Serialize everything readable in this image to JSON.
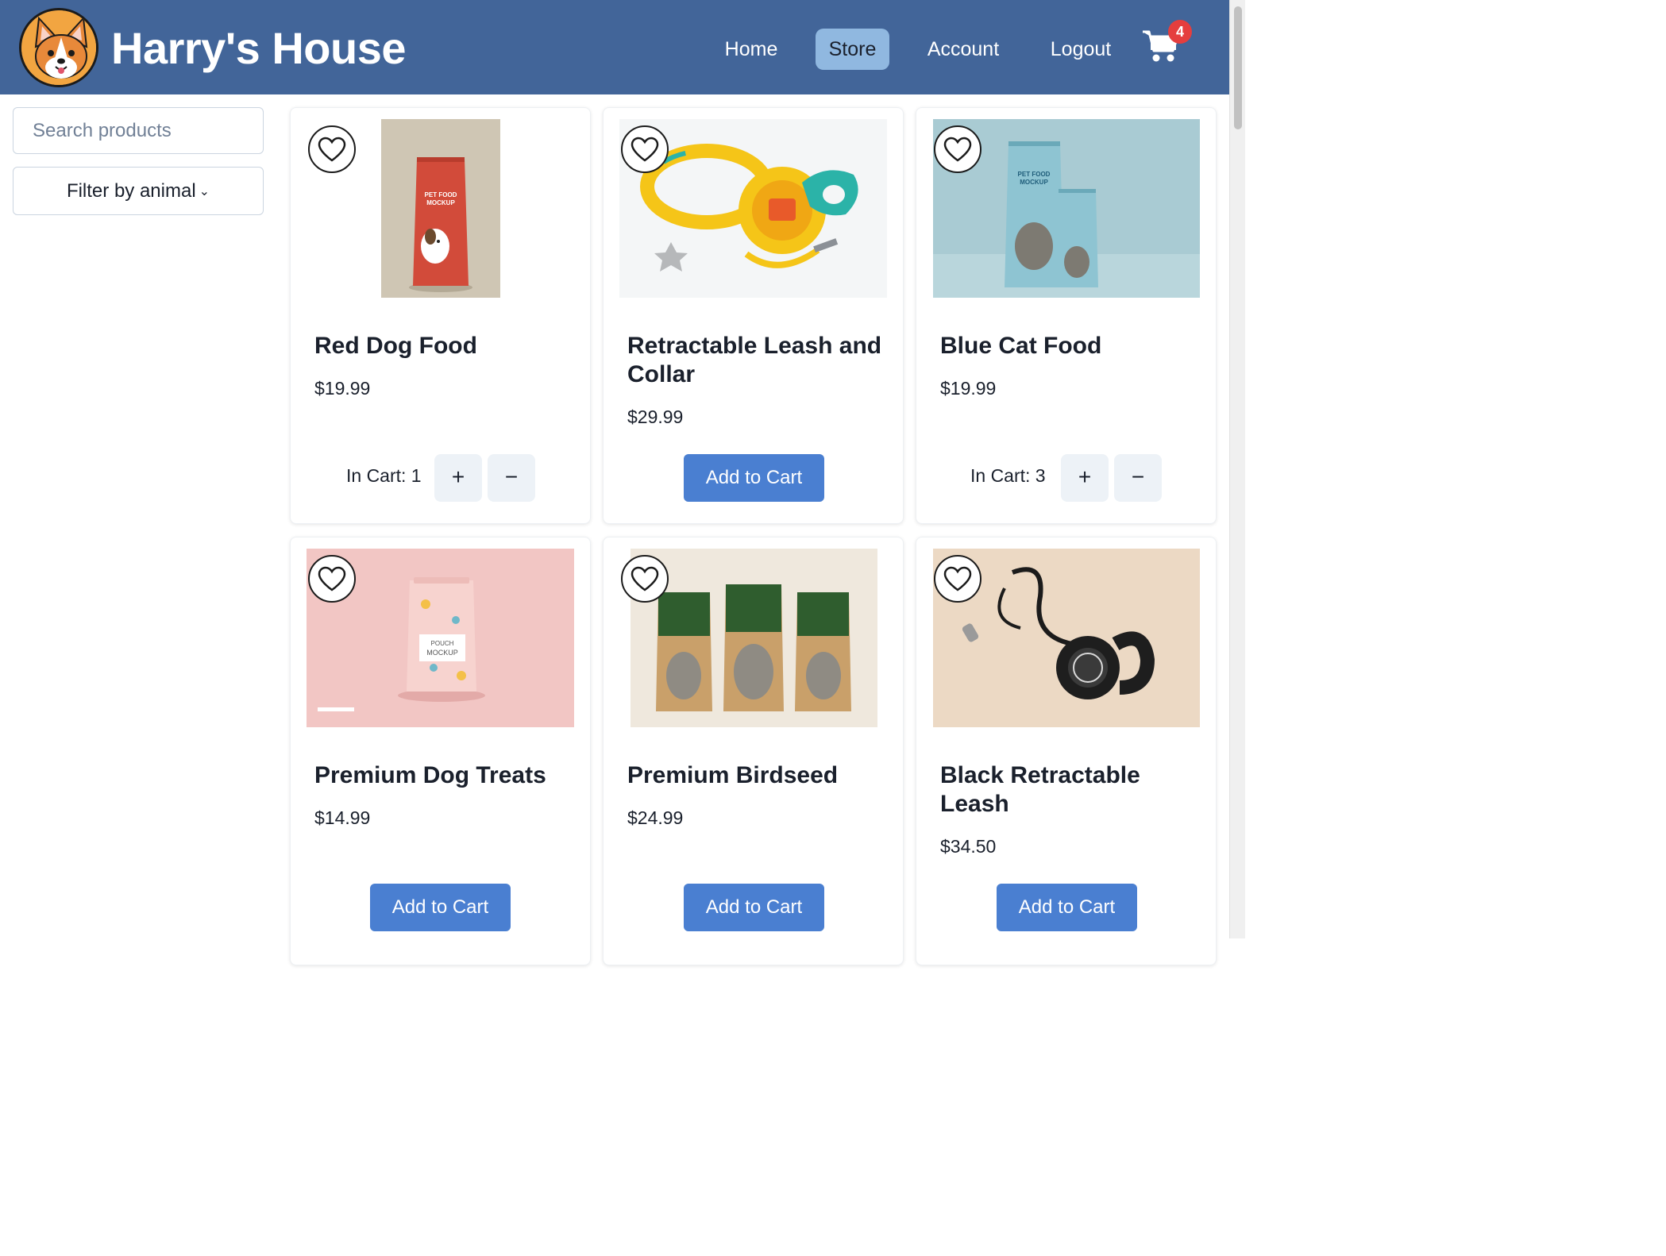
{
  "header": {
    "brand": "Harry's House",
    "nav": [
      {
        "label": "Home",
        "active": false
      },
      {
        "label": "Store",
        "active": true
      },
      {
        "label": "Account",
        "active": false
      },
      {
        "label": "Logout",
        "active": false
      }
    ],
    "cart_count": "4",
    "colors": {
      "bar": "#426599",
      "active_tab": "#90b8e0",
      "badge": "#e53e3e"
    }
  },
  "sidebar": {
    "search_placeholder": "Search products",
    "filter_label": "Filter by animal"
  },
  "products": [
    {
      "name": "Red Dog Food",
      "price": "$19.99",
      "in_cart_label": "In Cart: 1",
      "plus": "+",
      "minus": "−"
    },
    {
      "name": "Retractable Leash and Collar",
      "price": "$29.99",
      "add_label": "Add to Cart"
    },
    {
      "name": "Blue Cat Food",
      "price": "$19.99",
      "in_cart_label": "In Cart: 3",
      "plus": "+",
      "minus": "−"
    },
    {
      "name": "Premium Dog Treats",
      "price": "$14.99",
      "add_label": "Add to Cart"
    },
    {
      "name": "Premium Birdseed",
      "price": "$24.99",
      "add_label": "Add to Cart"
    },
    {
      "name": "Black Retractable Leash",
      "price": "$34.50",
      "add_label": "Add to Cart"
    }
  ],
  "accent_color": "#4a7fd1"
}
